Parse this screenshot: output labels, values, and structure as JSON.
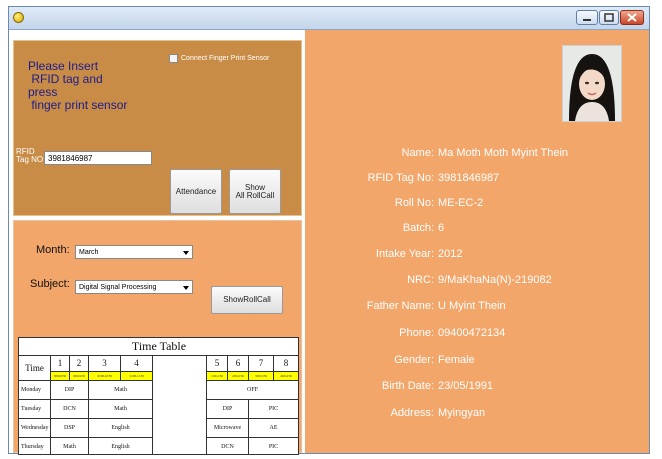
{
  "window": {
    "controls": {
      "minimize_icon": "minimize-icon",
      "maximize_icon": "maximize-icon",
      "close_icon": "close-icon"
    }
  },
  "insert_panel": {
    "prompt": "Please Insert\n RFID tag and\npress\n finger print sensor",
    "finger_print_checkbox": {
      "label": "Connect Finger Print Sensor",
      "checked": false
    },
    "rfid_label": "RFID\nTag NO:",
    "rfid_value": "3981846987",
    "attendance_button": "Attendance",
    "show_all_button": "Show\nAll RollCall"
  },
  "filter_panel": {
    "month_label": "Month:",
    "month_value": "March",
    "subject_label": "Subject:",
    "subject_value": "Digital Signal Processing",
    "show_roll_button": "ShowRollCall"
  },
  "timetable": {
    "title": "Time Table",
    "time_header": "Time",
    "periods": [
      "1",
      "2",
      "3",
      "4",
      "5",
      "6",
      "7",
      "8"
    ],
    "period_times": [
      "8:00-8:50",
      "9:00-9:50",
      "10:00-10:50",
      "11:00-11:50",
      "1:00-1:50",
      "2:00-2:50",
      "3:00-3:50",
      "4:00-4:50"
    ],
    "rows": [
      {
        "day": "Monday",
        "am1": "DIP",
        "am2": "Math",
        "pm": "OFF"
      },
      {
        "day": "Tuesday",
        "am1": "DCN",
        "am2": "Math",
        "pm1": "DIP",
        "pm2": "PIC"
      },
      {
        "day": "Wednesday",
        "am1": "DSP",
        "am2": "English",
        "pm1": "Microwave",
        "pm2": "AE"
      },
      {
        "day": "Thursday",
        "am1": "Math",
        "am2": "English",
        "pm1": "DCN",
        "pm2": "PIC"
      }
    ]
  },
  "student": {
    "fields": [
      {
        "label": "Name:",
        "value": "Ma Moth Moth Myint Thein"
      },
      {
        "label": "RFID Tag No:",
        "value": "3981846987"
      },
      {
        "label": "Roll No:",
        "value": "ME-EC-2"
      },
      {
        "label": "Batch:",
        "value": "6"
      },
      {
        "label": "Intake Year:",
        "value": "2012"
      },
      {
        "label": "NRC:",
        "value": "9/MaKhaNa(N)-219082"
      },
      {
        "label": "Father Name:",
        "value": "U Myint Thein"
      },
      {
        "label": "Phone:",
        "value": "09400472134"
      },
      {
        "label": "Gender:",
        "value": "Female"
      },
      {
        "label": "Birth Date:",
        "value": "23/05/1991"
      },
      {
        "label": "Address:",
        "value": "Myingyan"
      }
    ]
  },
  "colors": {
    "form_bg": "#f2a66a",
    "insert_panel_bg": "#c88c46",
    "prompt_text": "#1c1c8c",
    "period_time_bg": "#ffff00"
  }
}
